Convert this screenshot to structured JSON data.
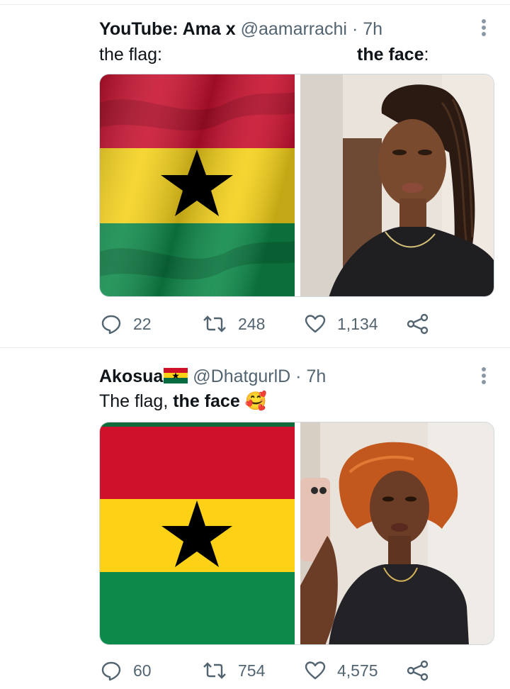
{
  "tweets": [
    {
      "display_name": "YouTube: Ama x",
      "handle": "@aamarrachi",
      "separator": "·",
      "time": "7h",
      "text_left": "the flag:",
      "text_right_bold": "the face",
      "text_right_suffix": ":",
      "reply_count": "22",
      "retweet_count": "248",
      "like_count": "1,134"
    },
    {
      "display_name": "Akosua",
      "handle": "@DhatgurlD",
      "separator": "·",
      "time": "7h",
      "text_plain": "The flag, ",
      "text_bold": "the face",
      "emoji": "🥰",
      "reply_count": "60",
      "retweet_count": "754",
      "like_count": "4,575"
    }
  ],
  "colors": {
    "flag_red": "#ce1126",
    "flag_gold": "#fcd116",
    "flag_green": "#006b3f",
    "star": "#000000",
    "secondary_text": "#536471",
    "icon_gray": "#536471"
  },
  "icons": {
    "reply": "reply-icon",
    "retweet": "retweet-icon",
    "like": "like-icon",
    "share": "share-icon",
    "more": "more-icon"
  }
}
